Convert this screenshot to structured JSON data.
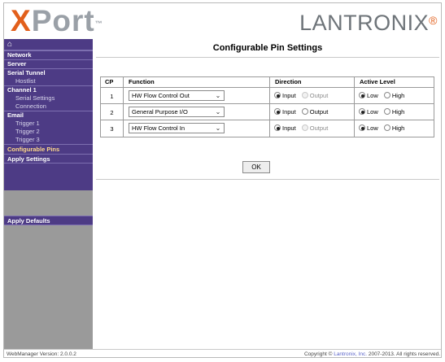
{
  "header": {
    "brand_x": "X",
    "brand_port": "Port",
    "brand_tm": "™",
    "company": "LANTRONIX",
    "company_mark": "®"
  },
  "sidebar": {
    "home_icon": "⌂",
    "items": [
      {
        "label": "Network",
        "kind": "section"
      },
      {
        "label": "Server",
        "kind": "section"
      },
      {
        "label": "Serial Tunnel",
        "kind": "section"
      },
      {
        "label": "Hostlist",
        "kind": "sub"
      },
      {
        "label": "Channel 1",
        "kind": "section"
      },
      {
        "label": "Serial Settings",
        "kind": "sub"
      },
      {
        "label": "Connection",
        "kind": "sub"
      },
      {
        "label": "Email",
        "kind": "section"
      },
      {
        "label": "Trigger 1",
        "kind": "sub"
      },
      {
        "label": "Trigger 2",
        "kind": "sub"
      },
      {
        "label": "Trigger 3",
        "kind": "sub"
      },
      {
        "label": "Configurable Pins",
        "kind": "active"
      },
      {
        "label": "Apply Settings",
        "kind": "apply"
      }
    ],
    "apply_defaults": "Apply Defaults"
  },
  "main": {
    "title": "Configurable Pin Settings",
    "table": {
      "headers": {
        "cp": "CP",
        "function": "Function",
        "direction": "Direction",
        "active_level": "Active Level"
      },
      "rows": [
        {
          "cp": "1",
          "function": "HW Flow Control Out",
          "dir_input": "Input",
          "dir_output": "Output",
          "dir_selected": "Input",
          "dir_output_disabled": true,
          "lvl_low": "Low",
          "lvl_high": "High",
          "lvl_selected": "Low"
        },
        {
          "cp": "2",
          "function": "General Purpose I/O",
          "dir_input": "Input",
          "dir_output": "Output",
          "dir_selected": "Input",
          "dir_output_disabled": false,
          "lvl_low": "Low",
          "lvl_high": "High",
          "lvl_selected": "Low"
        },
        {
          "cp": "3",
          "function": "HW Flow Control In",
          "dir_input": "Input",
          "dir_output": "Output",
          "dir_selected": "Input",
          "dir_output_disabled": true,
          "lvl_low": "Low",
          "lvl_high": "High",
          "lvl_selected": "Low"
        }
      ]
    },
    "ok_label": "OK"
  },
  "footer": {
    "version": "WebManager Version: 2.0.0.2",
    "copyright_prefix": "Copyright © ",
    "copyright_link": "Lantronix, Inc.",
    "copyright_suffix": " 2007-2013. All rights reserved."
  },
  "icons": {
    "chevron": "chevron-down-icon",
    "home": "home-icon"
  },
  "colors": {
    "nav_bg": "#4d3b85",
    "brand_orange": "#e25f1b",
    "sidebar_grey": "#9a9a9a",
    "active_text": "#ffd98a"
  }
}
